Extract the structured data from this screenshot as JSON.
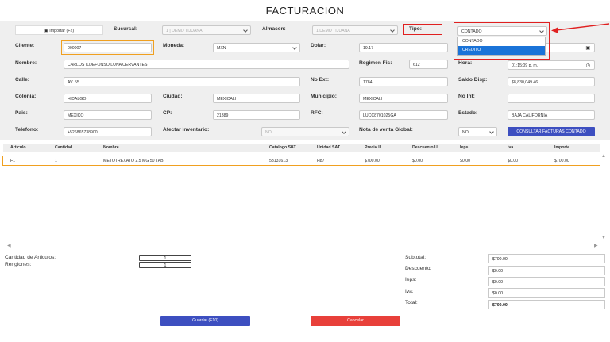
{
  "page_title": "FACTURACION",
  "import_button": "Importar (F2)",
  "labels": {
    "sucursal": "Sucursal:",
    "almacen": "Almacen:",
    "tipo": "Tipo:",
    "cliente": "Cliente:",
    "moneda": "Moneda:",
    "dolar": "Dolar:",
    "nombre": "Nombre:",
    "regimen": "Regimen Fis:",
    "hora": "Hora:",
    "calle": "Calle:",
    "no_ext": "No Ext:",
    "saldo": "Saldo Disp:",
    "colonia": "Colonia:",
    "ciudad": "Ciudad:",
    "municipio": "Municipio:",
    "no_int": "No Int:",
    "pais": "Pais:",
    "cp": "CP:",
    "rfc": "RFC:",
    "estado": "Estado:",
    "telefono": "Telefono:",
    "afectar": "Afectar Inventario:",
    "nota_global": "Nota de venta Global:"
  },
  "values": {
    "sucursal": "1 | DEMO TIJUANA",
    "almacen": "1|DEMO TIJUANA",
    "tipo": "CONTADO",
    "cliente": "000007",
    "moneda": "MXN",
    "dolar": "19.17",
    "nombre": "CARLOS ILDEFONSO LUNA CERVANTES",
    "regimen": "612",
    "hora": "01:15:09 p. m.",
    "calle": "AV. 55",
    "no_ext": "1784",
    "saldo": "$8,830,049.46",
    "colonia": "HIDALGO",
    "ciudad": "MEXICALI",
    "municipio": "MEXICALI",
    "no_int": "",
    "pais": "MEXICO",
    "cp": "21389",
    "rfc": "LUCC8701025GA",
    "estado": "BAJA CALIFORNIA",
    "telefono": "+526865738900",
    "afectar": "NO",
    "nota_global": "NO"
  },
  "tipo_options": [
    "CONTADO",
    "CREDITO"
  ],
  "consultar_button": "CONSULTAR FACTURAS CONTADO",
  "table": {
    "headers": [
      "Articulo",
      "Cantidad",
      "Nombre",
      "Catalogo SAT",
      "Unidad SAT",
      "Precio U.",
      "Descuento U.",
      "Ieps",
      "Iva",
      "Importe"
    ],
    "rows": [
      [
        "F1",
        "1",
        "METOTREXATO 2.5 MG 50 TAB",
        "53131613",
        "H87",
        "$700.00",
        "$0.00",
        "$0.00",
        "$0.00",
        "$700.00"
      ]
    ]
  },
  "counts": {
    "articulos_label": "Cantidad de Articulos:",
    "articulos_value": "1",
    "renglones_label": "Renglones:",
    "renglones_value": "1"
  },
  "totals": {
    "subtotal_label": "Subtotal:",
    "subtotal": "$700.00",
    "descuento_label": "Descuento:",
    "descuento": "$0.00",
    "ieps_label": "Ieps:",
    "ieps": "$0.00",
    "iva_label": "Iva:",
    "iva": "$0.00",
    "total_label": "Total:",
    "total": "$700.00"
  },
  "actions": {
    "guardar": "Guardar (F10)",
    "cancelar": "Cancelar"
  },
  "colors": {
    "primary": "#3d4fc0",
    "danger": "#e8403a",
    "highlight_orange": "#f0a020",
    "annotation_red": "#e02020",
    "dropdown_selected": "#1a73d8"
  }
}
